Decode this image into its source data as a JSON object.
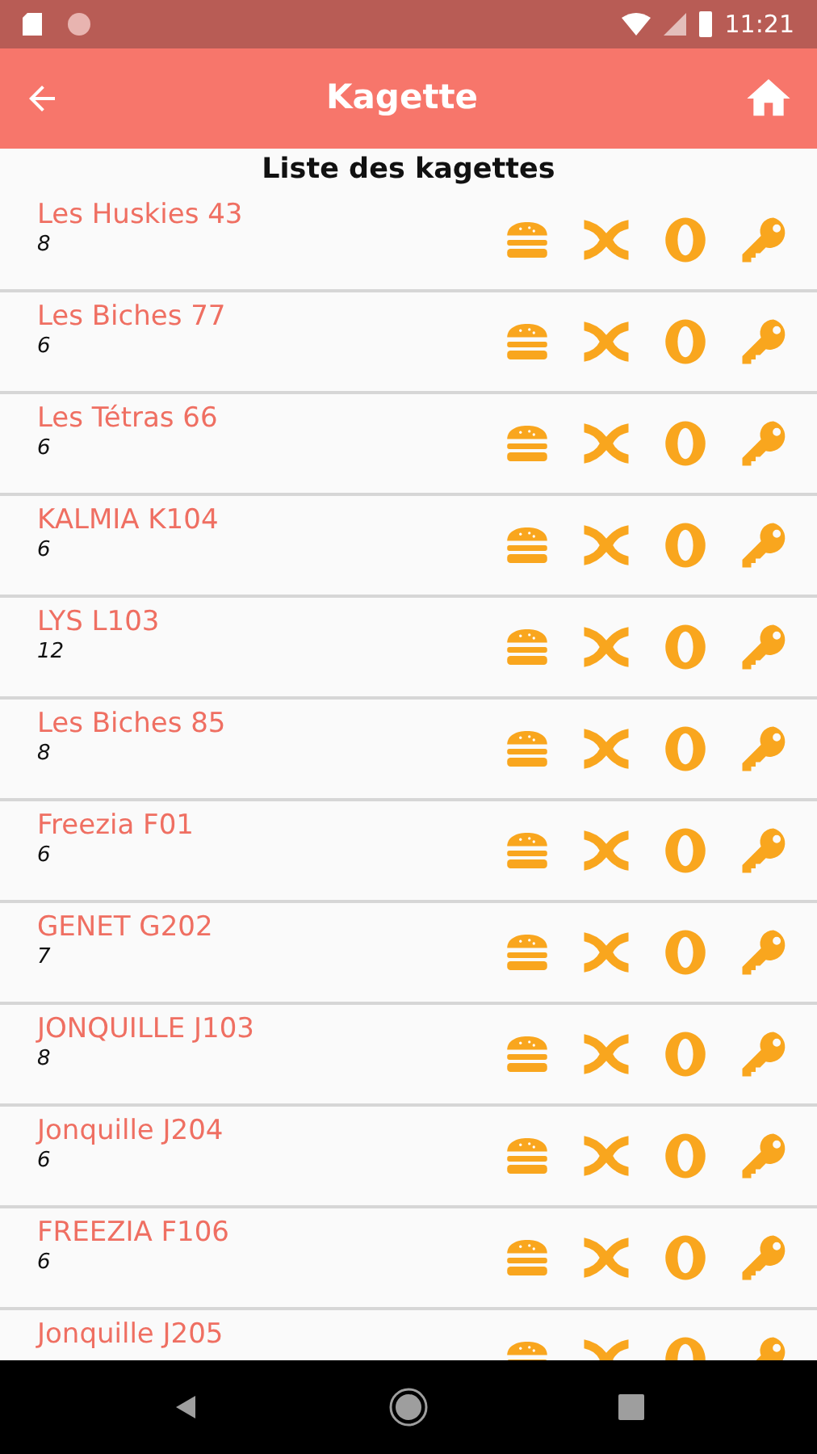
{
  "status_bar": {
    "time": "11:21"
  },
  "app_bar": {
    "title": "Kagette"
  },
  "heading": "Liste des kagettes",
  "kagettes": [
    {
      "name": "Les Huskies 43",
      "count": "8"
    },
    {
      "name": "Les Biches 77",
      "count": "6"
    },
    {
      "name": "Les Tétras 66",
      "count": "6"
    },
    {
      "name": "KALMIA K104",
      "count": "6"
    },
    {
      "name": "LYS L103",
      "count": "12"
    },
    {
      "name": "Les Biches 85",
      "count": "8"
    },
    {
      "name": "Freezia F01",
      "count": "6"
    },
    {
      "name": "GENET G202",
      "count": "7"
    },
    {
      "name": "JONQUILLE J103",
      "count": "8"
    },
    {
      "name": "Jonquille J204",
      "count": "6"
    },
    {
      "name": "FREEZIA F106",
      "count": "6"
    },
    {
      "name": "Jonquille J205"
    }
  ]
}
